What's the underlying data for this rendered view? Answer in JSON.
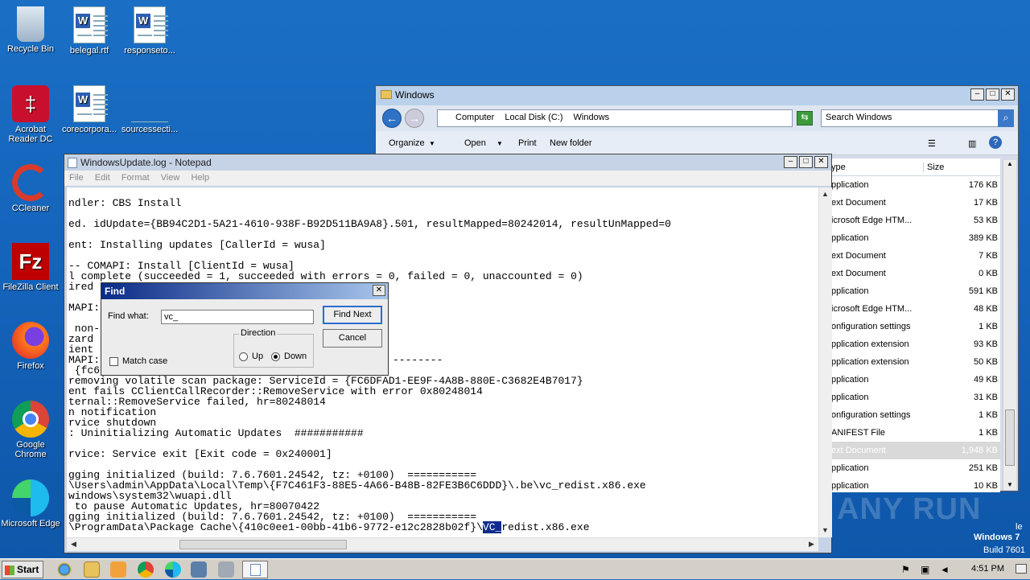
{
  "desktop": {
    "icons": [
      {
        "label": "Recycle Bin"
      },
      {
        "label": "belegal.rtf"
      },
      {
        "label": "responseto..."
      },
      {
        "label": "Acrobat Reader DC"
      },
      {
        "label": "corecorpora..."
      },
      {
        "label": "sourcessecti..."
      },
      {
        "label": "CCleaner"
      },
      {
        "label": "FileZilla Client"
      },
      {
        "label": "Firefox"
      },
      {
        "label": "Google Chrome"
      },
      {
        "label": "Microsoft Edge"
      }
    ],
    "watermark_os": "Windows 7",
    "watermark_build": "Build 7601",
    "watermark_fragment": "le",
    "anyrun_logo": "ANY RUN"
  },
  "explorer": {
    "title": "Windows",
    "breadcrumb": [
      "Computer",
      "Local Disk (C:)",
      "Windows"
    ],
    "search_placeholder": "Search Windows",
    "toolbar": {
      "organize": "Organize",
      "open": "Open",
      "print": "Print",
      "new_folder": "New folder"
    },
    "columns": {
      "type": "ype",
      "size": "Size"
    },
    "rows": [
      {
        "type": "pplication",
        "size": "176 KB"
      },
      {
        "type": "ext Document",
        "size": "17 KB"
      },
      {
        "type": "icrosoft Edge HTM...",
        "size": "53 KB"
      },
      {
        "type": "pplication",
        "size": "389 KB"
      },
      {
        "type": "ext Document",
        "size": "7 KB"
      },
      {
        "type": "ext Document",
        "size": "0 KB"
      },
      {
        "type": "pplication",
        "size": "591 KB"
      },
      {
        "type": "icrosoft Edge HTM...",
        "size": "48 KB"
      },
      {
        "type": "onfiguration settings",
        "size": "1 KB"
      },
      {
        "type": "pplication extension",
        "size": "93 KB"
      },
      {
        "type": "pplication extension",
        "size": "50 KB"
      },
      {
        "type": "pplication",
        "size": "49 KB"
      },
      {
        "type": "pplication",
        "size": "31 KB"
      },
      {
        "type": "onfiguration settings",
        "size": "1 KB"
      },
      {
        "type": "ANIFEST File",
        "size": "1 KB"
      },
      {
        "type": "ext Document",
        "size": "1,948 KB"
      },
      {
        "type": "pplication",
        "size": "251 KB"
      },
      {
        "type": "pplication",
        "size": "10 KB"
      }
    ]
  },
  "notepad": {
    "title": "WindowsUpdate.log - Notepad",
    "menu": [
      "File",
      "Edit",
      "Format",
      "View",
      "Help"
    ],
    "lines": [
      "ndler: CBS Install",
      "ed. idUpdate={BB94C2D1-5A21-4610-938F-B92D511BA9A8}.501, resultMapped=80242014, resultUnMapped=0",
      "ent: Installing updates [CallerId = wusa]",
      "-- COMAPI: Install [ClientId = wusa]",
      "l complete (succeeded = 1, succeeded with errors = 0, failed = 0, unaccounted = 0)",
      "ired",
      "MAPI:",
      " non-",
      "zard",
      "ient",
      "MAPI:",
      " {fc6",
      "removing volatile scan package: ServiceId = {FC6DFAD1-EE9F-4A8B-880E-C3682E4B7017}",
      "ent fails CClientCallRecorder::RemoveService with error 0x80248014",
      "ternal::RemoveService failed, hr=80248014",
      "n notification",
      "rvice shutdown",
      ": Uninitializing Automatic Updates  ###########",
      "rvice: Service exit [Exit code = 0x240001]",
      "gging initialized (build: 7.6.7601.24542, tz: +0100)  ===========",
      "\\Users\\admin\\AppData\\Local\\Temp\\{F7C461F3-88E5-4A66-B48B-82FE3B6C6DDD}\\.be\\vc_redist.x86.exe",
      "windows\\system32\\wuapi.dll",
      " to pause Automatic Updates, hr=80070422",
      "gging initialized (build: 7.6.7601.24542, tz: +0100)  ===========",
      "\\ProgramData\\Package Cache\\{410c0ee1-00bb-41b6-9772-e12c2828b02f}\\"
    ],
    "last_line_highlight": "VC_",
    "last_line_rest": "redist.x86.exe",
    "dash_fragment": "--------"
  },
  "find": {
    "title": "Find",
    "find_what_label": "Find what:",
    "find_what_value": "vc_",
    "find_next": "Find Next",
    "cancel": "Cancel",
    "direction_label": "Direction",
    "up_label": "Up",
    "down_label": "Down",
    "direction": "Down",
    "match_case_label": "Match case",
    "match_case": false
  },
  "taskbar": {
    "start": "Start",
    "clock": "4:51 PM"
  }
}
